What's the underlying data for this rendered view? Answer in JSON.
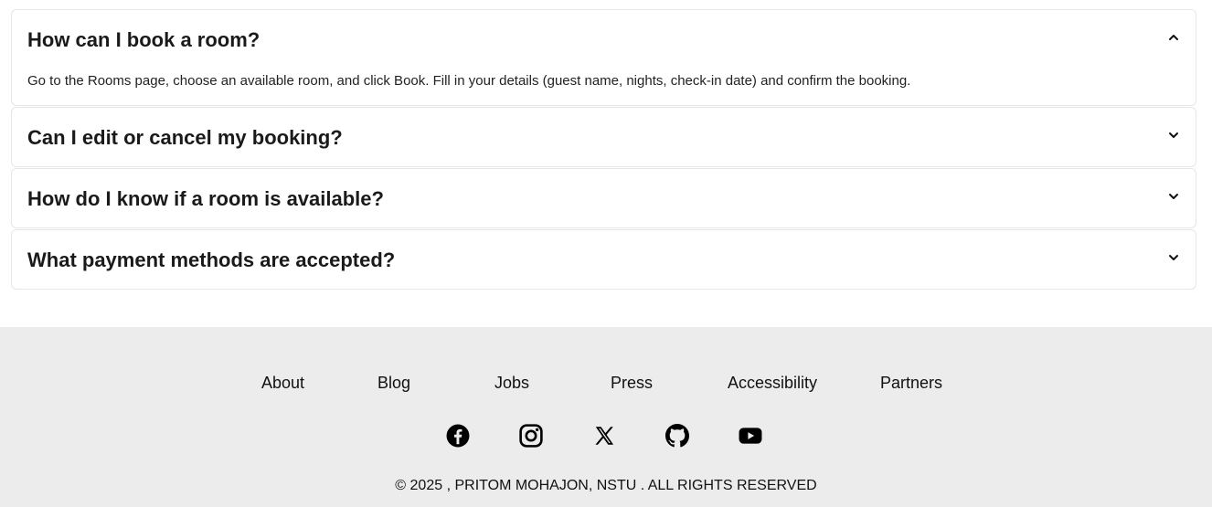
{
  "faq": {
    "items": [
      {
        "question": "How can I book a room?",
        "answer": "Go to the Rooms page, choose an available room, and click Book. Fill in your details (guest name, nights, check-in date) and confirm the booking.",
        "expanded": true
      },
      {
        "question": "Can I edit or cancel my booking?",
        "expanded": false
      },
      {
        "question": "How do I know if a room is available?",
        "expanded": false
      },
      {
        "question": "What payment methods are accepted?",
        "expanded": false
      }
    ]
  },
  "footer": {
    "links": [
      "About",
      "Blog",
      "Jobs",
      "Press",
      "Accessibility",
      "Partners"
    ],
    "social_icons": [
      "facebook-icon",
      "instagram-icon",
      "x-icon",
      "github-icon",
      "youtube-icon"
    ],
    "copyright": "© 2025 , PRITOM MOHAJON, NSTU . ALL RIGHTS RESERVED",
    "background_color": "#ececec"
  }
}
